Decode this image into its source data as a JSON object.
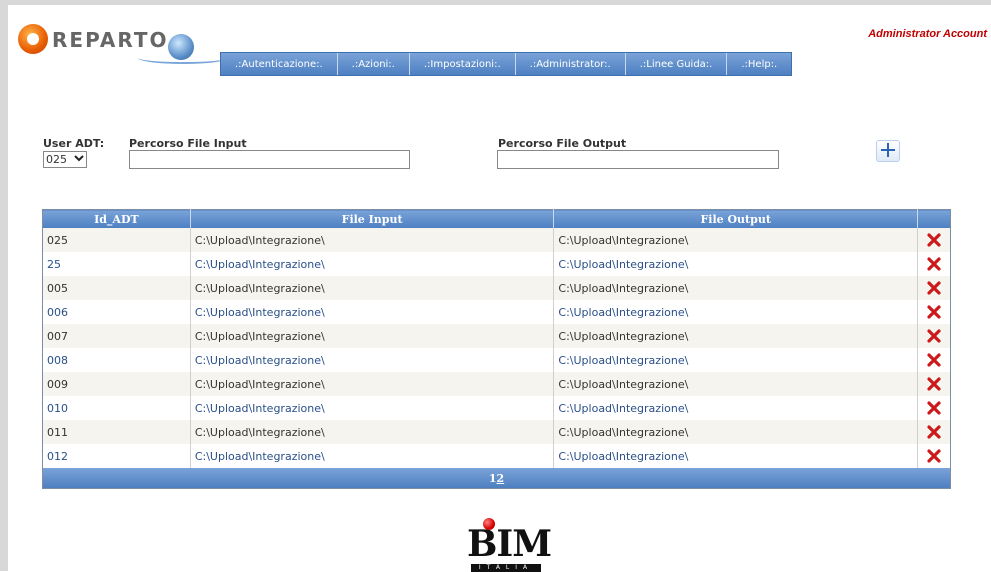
{
  "header": {
    "logo_text": "REPARTO",
    "account": "Administrator Account"
  },
  "menu": {
    "items": [
      ".:Autenticazione:.",
      ".:Azioni:.",
      ".:Impostazioni:.",
      ".:Administrator:.",
      ".:Linee Guida:.",
      ".:Help:."
    ]
  },
  "form": {
    "user_adt_label": "User ADT:",
    "user_adt_value": "025",
    "input_label": "Percorso File Input",
    "input_value": "",
    "output_label": "Percorso File Output",
    "output_value": ""
  },
  "table": {
    "headers": [
      "Id_ADT",
      "File Input",
      "File Output",
      ""
    ],
    "rows": [
      {
        "id": "025",
        "input": "C:\\Upload\\Integrazione\\",
        "output": "C:\\Upload\\Integrazione\\"
      },
      {
        "id": "25",
        "input": "C:\\Upload\\Integrazione\\",
        "output": "C:\\Upload\\Integrazione\\"
      },
      {
        "id": "005",
        "input": "C:\\Upload\\Integrazione\\",
        "output": "C:\\Upload\\Integrazione\\"
      },
      {
        "id": "006",
        "input": "C:\\Upload\\Integrazione\\",
        "output": "C:\\Upload\\Integrazione\\"
      },
      {
        "id": "007",
        "input": "C:\\Upload\\Integrazione\\",
        "output": "C:\\Upload\\Integrazione\\"
      },
      {
        "id": "008",
        "input": "C:\\Upload\\Integrazione\\",
        "output": "C:\\Upload\\Integrazione\\"
      },
      {
        "id": "009",
        "input": "C:\\Upload\\Integrazione\\",
        "output": "C:\\Upload\\Integrazione\\"
      },
      {
        "id": "010",
        "input": "C:\\Upload\\Integrazione\\",
        "output": "C:\\Upload\\Integrazione\\"
      },
      {
        "id": "011",
        "input": "C:\\Upload\\Integrazione\\",
        "output": "C:\\Upload\\Integrazione\\"
      },
      {
        "id": "012",
        "input": "C:\\Upload\\Integrazione\\",
        "output": "C:\\Upload\\Integrazione\\"
      }
    ],
    "pager": {
      "current": "1",
      "other": "2"
    }
  },
  "footer": {
    "logo_text": "BIM",
    "logo_sub": "ITALIA"
  },
  "colors": {
    "header_blue": "#4d7fc1",
    "delete_red": "#cc1a1a",
    "account_red": "#c00000"
  }
}
